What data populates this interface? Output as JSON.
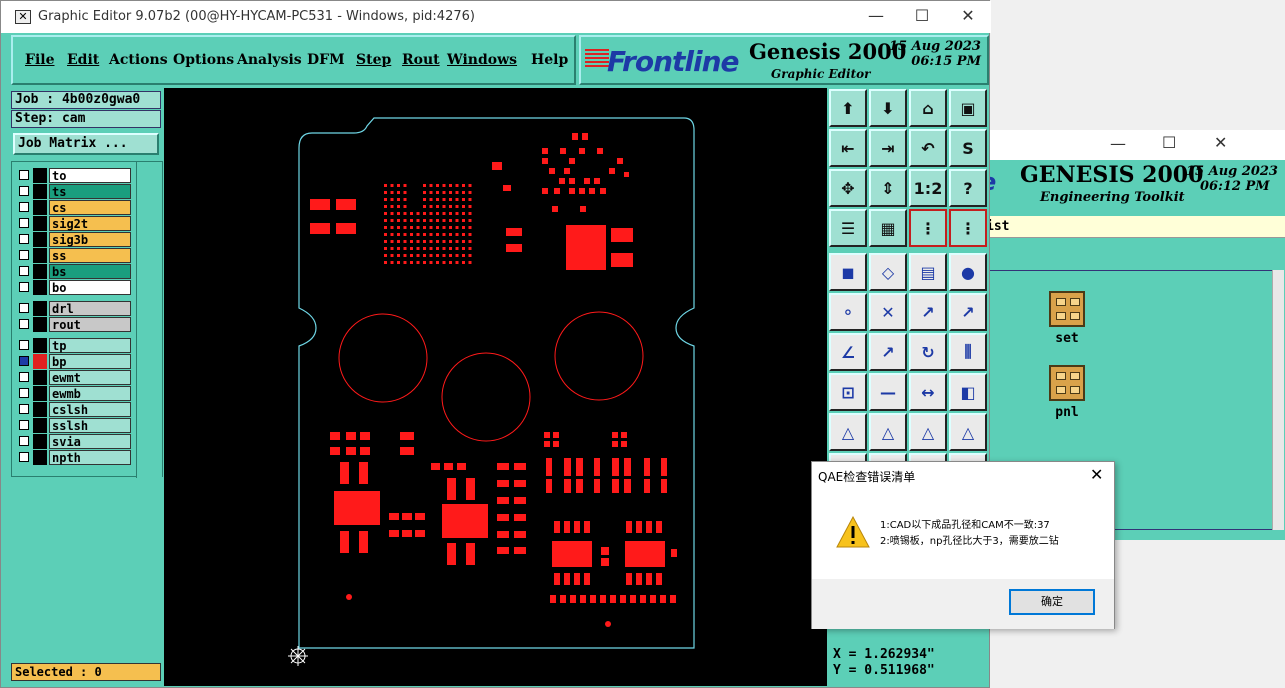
{
  "bg_window": {
    "brand_suffix": "e",
    "title": "GENESIS 2000",
    "subtitle": "Engineering Toolkit",
    "date": "15 Aug 2023",
    "time": "06:12 PM",
    "tab_text": "ist",
    "entities": [
      {
        "label": "set"
      },
      {
        "label": "pnl"
      }
    ]
  },
  "main_window": {
    "title": "Graphic Editor 9.07b2 (00@HY-HYCAM-PC531 - Windows, pid:4276)",
    "menu": [
      "File",
      "Edit",
      "Actions",
      "Options",
      "Analysis",
      "DFM",
      "Step",
      "Rout",
      "Windows",
      "Help"
    ],
    "brand": "Frontline",
    "product": "Genesis 2000",
    "product_sub": "Graphic Editor",
    "date": "15 Aug 2023",
    "time": "06:15 PM"
  },
  "left_panel": {
    "job": "Job : 4b00z0gwa0",
    "step": "Step: cam",
    "job_matrix": "Job Matrix ...",
    "layers_group1": [
      {
        "name": "to",
        "color": "#ffffff"
      },
      {
        "name": "ts",
        "color": "#1a9e7e"
      },
      {
        "name": "cs",
        "color": "#f5bf4f"
      },
      {
        "name": "sig2t",
        "color": "#f5bf4f"
      },
      {
        "name": "sig3b",
        "color": "#f5bf4f"
      },
      {
        "name": "ss",
        "color": "#f5bf4f"
      },
      {
        "name": "bs",
        "color": "#1a9e7e"
      },
      {
        "name": "bo",
        "color": "#ffffff"
      }
    ],
    "layers_group2": [
      {
        "name": "drl",
        "color": "#c8c8c8"
      },
      {
        "name": "rout",
        "color": "#c8c8c8"
      }
    ],
    "layers_group3": [
      {
        "name": "tp",
        "color": "#9fe0d2"
      },
      {
        "name": "bp",
        "color": "#9fe0d2",
        "active": true
      },
      {
        "name": "ewmt",
        "color": "#9fe0d2"
      },
      {
        "name": "ewmb",
        "color": "#9fe0d2"
      },
      {
        "name": "cslsh",
        "color": "#9fe0d2"
      },
      {
        "name": "sslsh",
        "color": "#9fe0d2"
      },
      {
        "name": "svia",
        "color": "#9fe0d2"
      },
      {
        "name": "npth",
        "color": "#9fe0d2"
      }
    ],
    "selected": "Selected : 0"
  },
  "toolbox": {
    "row_labels": [
      "",
      "",
      "",
      "",
      "",
      "",
      "",
      "",
      "",
      "",
      "",
      "",
      "",
      "1:2",
      "?"
    ]
  },
  "coords": {
    "x": "X = 1.262934\"",
    "y": "Y = 0.511968\""
  },
  "dialog": {
    "title": "QAE检查错误清单",
    "line1": "1:CAD以下成品孔径和CAM不一致:37",
    "line2": "2:喷锡板，np孔径比大于3，需要放二钻",
    "ok": "确定"
  }
}
